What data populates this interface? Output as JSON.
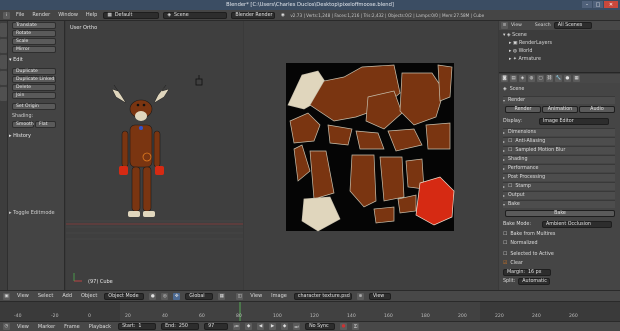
{
  "window": {
    "title": "Blender* [C:\\Users\\Charles Duclos\\Desktop\\pixeloffmoose.blend]",
    "min": "–",
    "max": "□",
    "close": "✕"
  },
  "topbar": {
    "menus": [
      "File",
      "Render",
      "Window",
      "Help"
    ],
    "layout": "Default",
    "scene": "Scene",
    "engine": "Blender Render",
    "info": "v2.73 | Verts:1,248 | Faces:1,216 | Tris:2,432 | Objects:0/2 | Lamps:0/0 | Mem:27.58M | Cube"
  },
  "toolshelf": {
    "top_buttons": [
      "Translate",
      "Rotate",
      "Scale",
      "Mirror"
    ],
    "edit_header": "Edit",
    "edit_buttons": [
      "Duplicate",
      "Duplicate Linked",
      "Delete",
      "Join"
    ],
    "origin": "Set Origin",
    "shading_label": "Shading:",
    "smooth": "Smooth",
    "flat": "Flat",
    "history": "History",
    "operator": "Toggle Editmode"
  },
  "viewport": {
    "label": "User Ortho",
    "object": "(97) Cube"
  },
  "outliner": {
    "view": "View",
    "search": "Search",
    "scenes": "All Scenes",
    "items": [
      "Scene",
      "RenderLayers",
      "World",
      "Armature"
    ]
  },
  "properties": {
    "breadcrumb": "Scene",
    "render_header": "Render",
    "render_buttons": [
      "Render",
      "Animation",
      "Audio"
    ],
    "display_label": "Display:",
    "display_value": "Image Editor",
    "panels": [
      "Dimensions",
      "Anti-Aliasing",
      "Sampled Motion Blur",
      "Shading",
      "Performance",
      "Post Processing",
      "Stamp",
      "Output"
    ],
    "bake_header": "Bake",
    "bake_button": "Bake",
    "bake_mode_label": "Bake Mode:",
    "bake_mode": "Ambient Occlusion",
    "bake_from_multires": "Bake from Multires",
    "normalized": "Normalized",
    "selected_to_active": "Selected to Active",
    "clear": "Clear",
    "margin_label": "Margin:",
    "margin": "16 px",
    "split_label": "Split:",
    "split": "Automatic",
    "freestyle": "Freestyle"
  },
  "view3d_header": {
    "menus": [
      "View",
      "Select",
      "Add",
      "Object"
    ],
    "mode": "Object Mode",
    "pivot": "Global",
    "uv_menus": [
      "View",
      "Image"
    ],
    "image_name": "character texture.psd",
    "uv_view": "View"
  },
  "timeline": {
    "ticks": [
      "-40",
      "-20",
      "0",
      "20",
      "40",
      "60",
      "80",
      "100",
      "120",
      "140",
      "160",
      "180",
      "200",
      "220",
      "240",
      "260"
    ],
    "menus": [
      "View",
      "Marker",
      "Frame",
      "Playback"
    ],
    "start_label": "Start:",
    "start": "1",
    "end_label": "End:",
    "end": "250",
    "current": "97",
    "sync": "No Sync"
  },
  "colors": {
    "accent": "#e07a1f",
    "brown": "#7a3511",
    "red": "#d62a13",
    "bone": "#e0d6bd"
  }
}
